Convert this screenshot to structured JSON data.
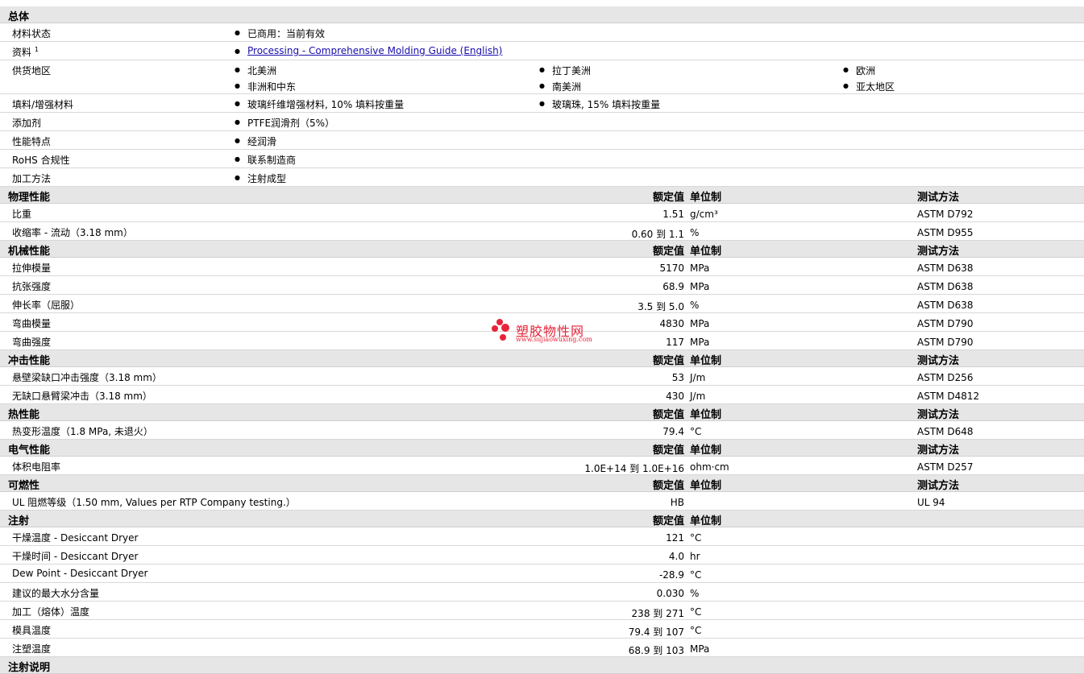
{
  "headers": {
    "value": "额定值",
    "unit": "单位制",
    "method": "测试方法"
  },
  "general": {
    "title": "总体",
    "material_status": {
      "label": "材料状态",
      "values": [
        "已商用：当前有效"
      ]
    },
    "documents": {
      "label": "资料",
      "sup": "1",
      "link": "Processing - Comprehensive Molding Guide (English)"
    },
    "supply_region": {
      "label": "供货地区",
      "values": [
        "北美洲",
        "拉丁美洲",
        "欧洲",
        "非洲和中东",
        "南美洲",
        "亚太地区"
      ]
    },
    "filler": {
      "label": "填料/增强材料",
      "values": [
        "玻璃纤维增强材料, 10% 填料按重量",
        "玻璃珠, 15% 填料按重量"
      ]
    },
    "additive": {
      "label": "添加剂",
      "values": [
        "PTFE润滑剂（5%）"
      ]
    },
    "features": {
      "label": "性能特点",
      "values": [
        "经润滑"
      ]
    },
    "rohs": {
      "label": "RoHS 合规性",
      "values": [
        "联系制造商"
      ]
    },
    "processing": {
      "label": "加工方法",
      "values": [
        "注射成型"
      ]
    }
  },
  "sections": [
    {
      "title": "物理性能",
      "show_method": true,
      "rows": [
        {
          "label": "比重",
          "value": "1.51",
          "unit": "g/cm³",
          "method": "ASTM D792"
        },
        {
          "label": "收缩率  - 流动（3.18 mm）",
          "value": "0.60 到  1.1",
          "unit": "%",
          "method": "ASTM D955"
        }
      ]
    },
    {
      "title": "机械性能",
      "show_method": true,
      "rows": [
        {
          "label": "拉伸模量",
          "value": "5170",
          "unit": "MPa",
          "method": "ASTM D638"
        },
        {
          "label": "抗张强度",
          "value": "68.9",
          "unit": "MPa",
          "method": "ASTM D638"
        },
        {
          "label": "伸长率（屈服）",
          "value": "3.5 到  5.0",
          "unit": "%",
          "method": "ASTM D638"
        },
        {
          "label": "弯曲模量",
          "value": "4830",
          "unit": "MPa",
          "method": "ASTM D790"
        },
        {
          "label": "弯曲强度",
          "value": "117",
          "unit": "MPa",
          "method": "ASTM D790"
        }
      ]
    },
    {
      "title": "冲击性能",
      "show_method": true,
      "rows": [
        {
          "label": "悬壁梁缺口冲击强度（3.18 mm）",
          "value": "53",
          "unit": "J/m",
          "method": "ASTM D256"
        },
        {
          "label": "无缺口悬臂梁冲击（3.18 mm）",
          "value": "430",
          "unit": "J/m",
          "method": "ASTM D4812"
        }
      ]
    },
    {
      "title": "热性能",
      "show_method": true,
      "rows": [
        {
          "label": "热变形温度（1.8 MPa, 未退火）",
          "value": "79.4",
          "unit": "°C",
          "method": "ASTM D648"
        }
      ]
    },
    {
      "title": "电气性能",
      "show_method": true,
      "rows": [
        {
          "label": "体积电阻率",
          "value": "1.0E+14 到  1.0E+16",
          "unit": "ohm·cm",
          "method": "ASTM D257"
        }
      ]
    },
    {
      "title": "可燃性",
      "show_method": true,
      "rows": [
        {
          "label": "UL 阻燃等级（1.50 mm, Values per RTP Company testing.）",
          "value": "HB",
          "unit": "",
          "method": "UL 94"
        }
      ]
    },
    {
      "title": "注射",
      "show_method": false,
      "rows": [
        {
          "label": "干燥温度  - Desiccant Dryer",
          "value": "121",
          "unit": "°C",
          "method": ""
        },
        {
          "label": "干燥时间  - Desiccant Dryer",
          "value": "4.0",
          "unit": "hr",
          "method": ""
        },
        {
          "label": "Dew Point - Desiccant Dryer",
          "value": "-28.9",
          "unit": "°C",
          "method": ""
        },
        {
          "label": "建议的最大水分含量",
          "value": "0.030",
          "unit": "%",
          "method": ""
        },
        {
          "label": "加工（熔体）温度",
          "value": "238 到  271",
          "unit": "°C",
          "method": ""
        },
        {
          "label": "模具温度",
          "value": "79.4 到  107",
          "unit": "°C",
          "method": ""
        },
        {
          "label": "注塑温度",
          "value": "68.9 到  103",
          "unit": "MPa",
          "method": ""
        }
      ]
    },
    {
      "title": "注射说明",
      "show_method": false,
      "rows": []
    }
  ],
  "watermark": {
    "title": "塑胶物性网",
    "url": "www.sujiaowuxing.com",
    "color": "#e8243a"
  }
}
